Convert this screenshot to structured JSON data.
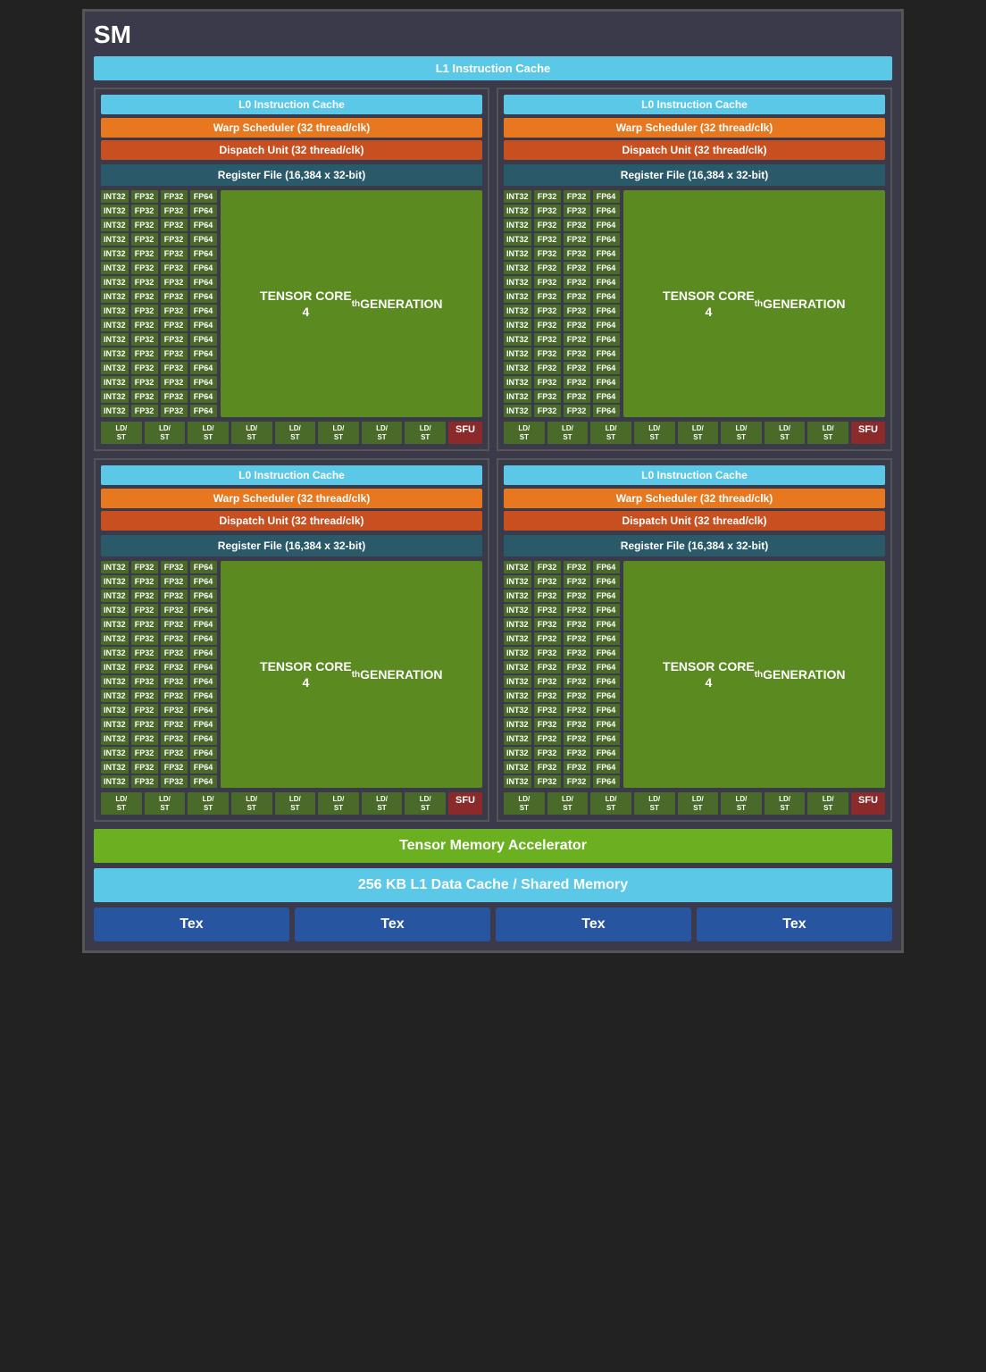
{
  "sm_title": "SM",
  "l1_instruction_cache": "L1 Instruction Cache",
  "sub_units": {
    "l0_cache": "L0 Instruction Cache",
    "warp_scheduler": "Warp Scheduler (32 thread/clk)",
    "dispatch_unit": "Dispatch Unit (32 thread/clk)",
    "register_file": "Register File (16,384 x 32-bit)",
    "tensor_core_label": "TENSOR CORE",
    "tensor_core_gen": "4",
    "tensor_core_gen_suffix": "th",
    "tensor_core_generation": "GENERATION",
    "sfu_label": "SFU",
    "alu_rows": 16,
    "int32": "INT32",
    "fp32a": "FP32",
    "fp32b": "FP32",
    "fp64": "FP64"
  },
  "ldst_labels": [
    "LD/\nST",
    "LD/\nST",
    "LD/\nST",
    "LD/\nST",
    "LD/\nST",
    "LD/\nST",
    "LD/\nST",
    "LD/\nST"
  ],
  "bottom": {
    "tensor_memory": "Tensor Memory Accelerator",
    "l1_data_cache": "256 KB L1 Data Cache / Shared Memory",
    "tex_labels": [
      "Tex",
      "Tex",
      "Tex",
      "Tex"
    ]
  }
}
